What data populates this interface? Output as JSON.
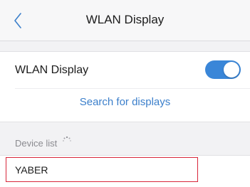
{
  "header": {
    "title": "WLAN Display",
    "back_icon": "chevron-left-icon"
  },
  "settings": {
    "wlan_display_label": "WLAN Display",
    "wlan_display_enabled": true,
    "search_link": "Search for displays"
  },
  "device_list": {
    "header": "Device list",
    "scanning_icon": "spinner-icon",
    "devices": [
      {
        "name": "YABER"
      }
    ]
  },
  "colors": {
    "accent": "#3a86d8",
    "link": "#3b7fcb",
    "highlight_border": "#d8263a"
  }
}
